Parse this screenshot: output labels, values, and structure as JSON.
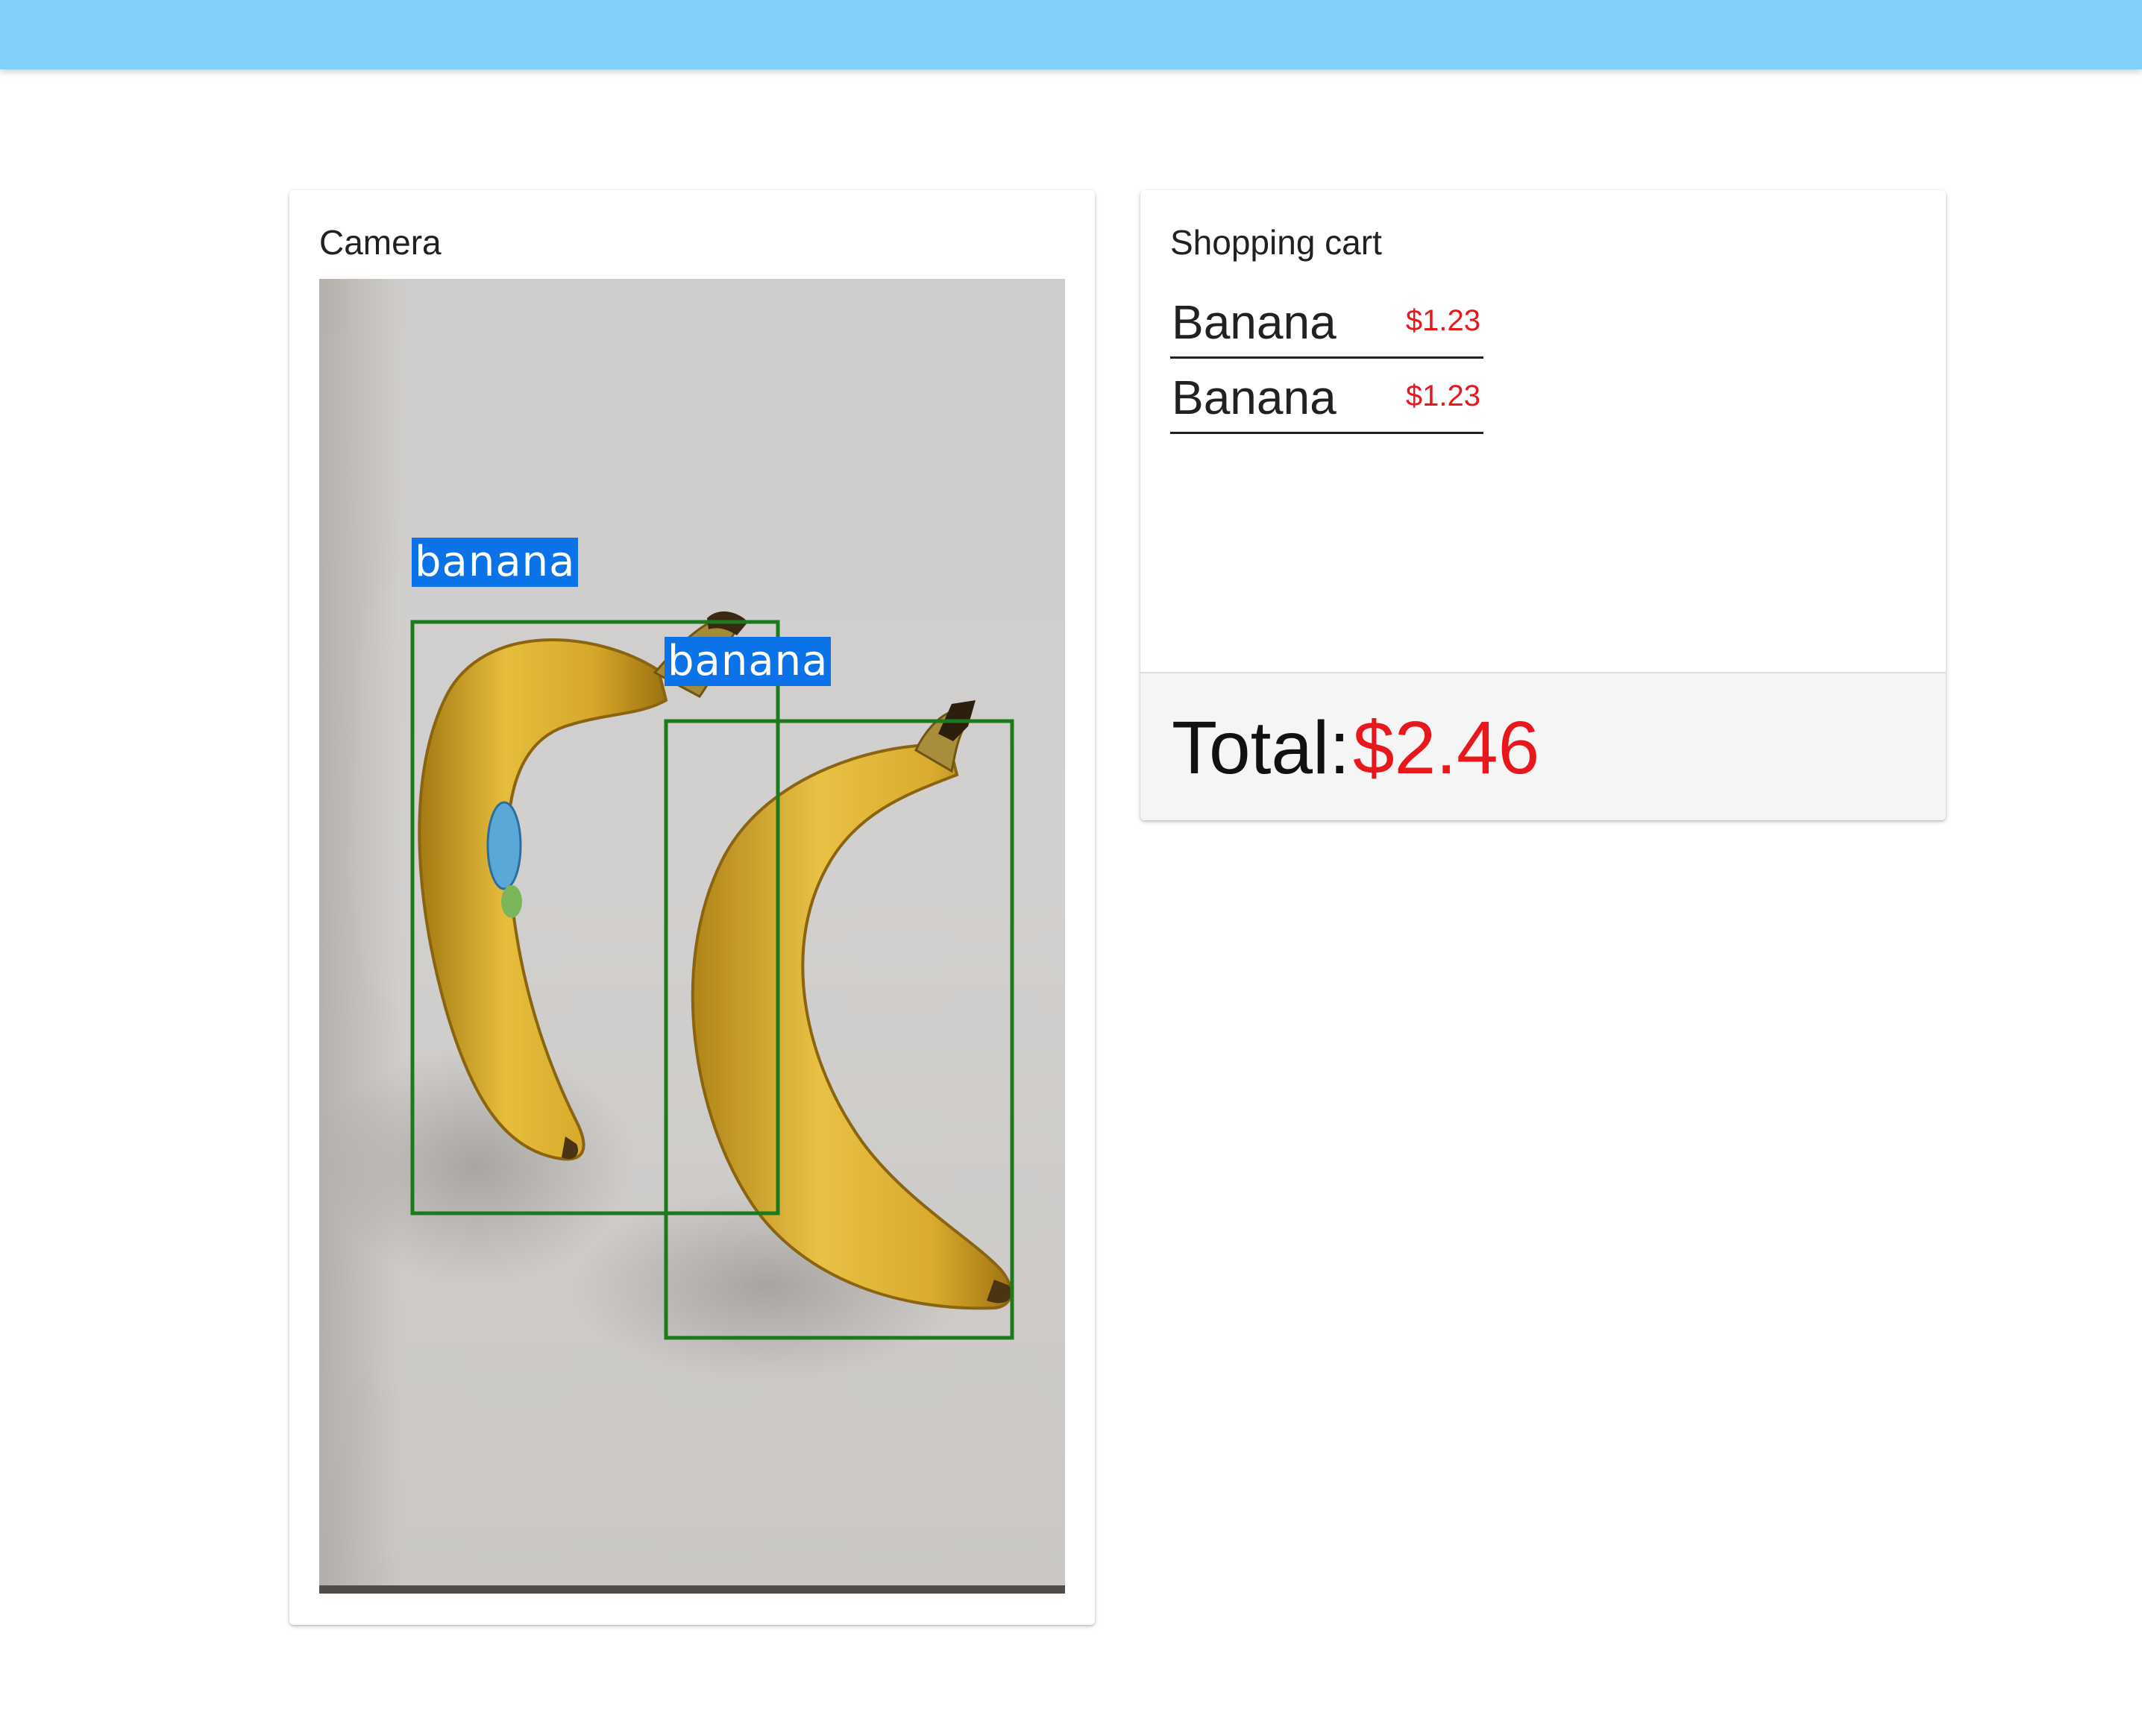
{
  "camera": {
    "title": "Camera",
    "detections": [
      {
        "label": "banana",
        "box_color": "#1c7a1c",
        "label_bg": "#0b72e7"
      },
      {
        "label": "banana",
        "box_color": "#1c7a1c",
        "label_bg": "#0b72e7"
      }
    ]
  },
  "cart": {
    "title": "Shopping cart",
    "items": [
      {
        "name": "Banana",
        "price": "$1.23"
      },
      {
        "name": "Banana",
        "price": "$1.23"
      }
    ],
    "total_label": "Total:",
    "total_value": "$2.46"
  },
  "colors": {
    "topbar": "#81d1f8",
    "price": "#e8171c",
    "footer_bg": "#f5f5f5"
  }
}
